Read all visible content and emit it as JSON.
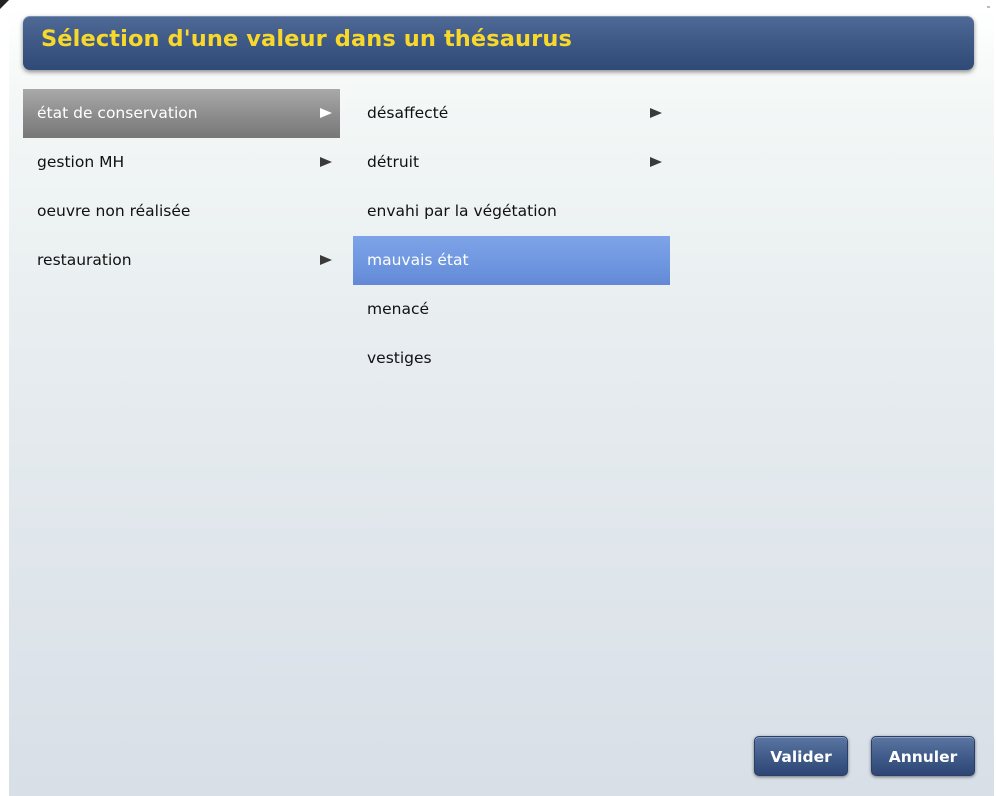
{
  "dialog": {
    "title": "Sélection d'une valeur dans un thésaurus"
  },
  "column1": {
    "items": [
      {
        "label": "état de conservation",
        "has_children": true,
        "state": "expanded"
      },
      {
        "label": "gestion MH",
        "has_children": true,
        "state": "normal"
      },
      {
        "label": "oeuvre non réalisée",
        "has_children": false,
        "state": "normal"
      },
      {
        "label": "restauration",
        "has_children": true,
        "state": "normal"
      }
    ]
  },
  "column2": {
    "items": [
      {
        "label": "désaffecté",
        "has_children": true,
        "state": "normal"
      },
      {
        "label": "détruit",
        "has_children": true,
        "state": "normal"
      },
      {
        "label": "envahi par la végétation",
        "has_children": false,
        "state": "normal"
      },
      {
        "label": "mauvais état",
        "has_children": false,
        "state": "selected"
      },
      {
        "label": "menacé",
        "has_children": false,
        "state": "normal"
      },
      {
        "label": "vestiges",
        "has_children": false,
        "state": "normal"
      }
    ]
  },
  "buttons": {
    "ok_label": "Valider",
    "cancel_label": "Annuler"
  },
  "colors": {
    "title_text": "#f8d82a",
    "title_bar": "#3f5a87",
    "selection": "#6f97e0",
    "expanded_path": "#8c8c8c",
    "button": "#3f5a88"
  },
  "icons": {
    "submenu": "submenu-arrow-icon"
  }
}
